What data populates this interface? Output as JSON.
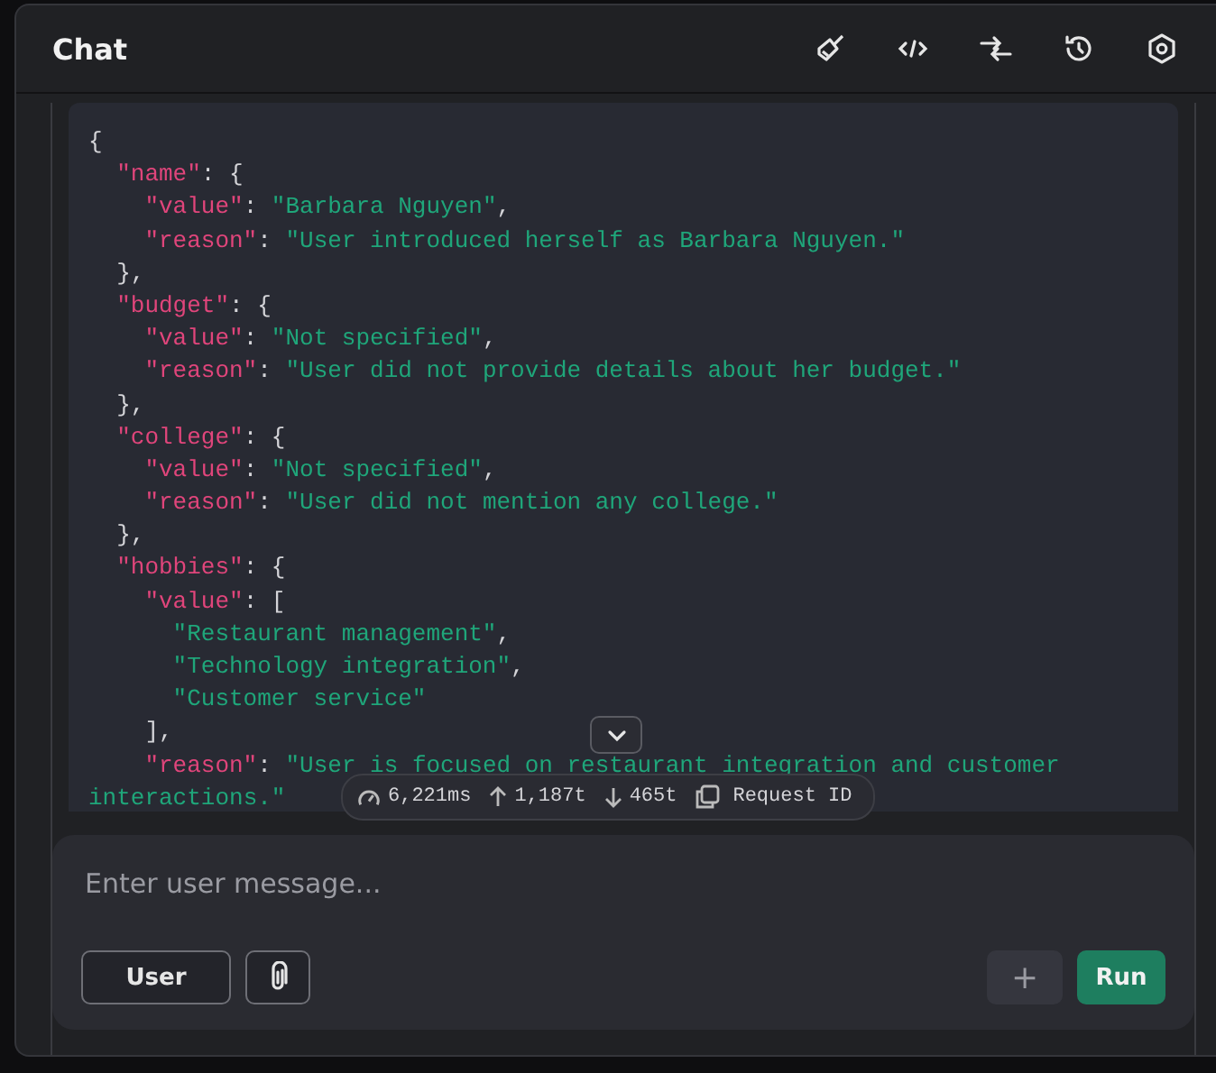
{
  "header": {
    "title": "Chat",
    "tools": [
      {
        "kind": "brush"
      },
      {
        "kind": "code"
      },
      {
        "kind": "arrows"
      },
      {
        "kind": "history"
      },
      {
        "kind": "settings"
      }
    ]
  },
  "code_lines": [
    {
      "parts": [
        {
          "kind": "punct",
          "text": "{"
        }
      ]
    },
    {
      "parts": [
        {
          "kind": "key",
          "text": "\"name\""
        },
        {
          "kind": "punct",
          "text": ":"
        },
        {
          "kind": "punct",
          "text": "{"
        }
      ]
    },
    {
      "parts": [
        {
          "kind": "key",
          "text": "\"value\""
        },
        {
          "kind": "punct",
          "text": ":"
        },
        {
          "kind": "str",
          "text": "\"Barbara Nguyen\""
        },
        {
          "kind": "punct",
          "text": ","
        }
      ]
    },
    {
      "parts": [
        {
          "kind": "key",
          "text": "\"reason\""
        },
        {
          "kind": "punct",
          "text": ":"
        },
        {
          "kind": "str",
          "text": "\"User introduced herself as Barbara Nguyen.\""
        }
      ]
    },
    {
      "parts": [
        {
          "kind": "punct",
          "text": "},"
        }
      ]
    },
    {
      "parts": [
        {
          "kind": "key",
          "text": "\"budget\""
        },
        {
          "kind": "punct",
          "text": ":"
        },
        {
          "kind": "punct",
          "text": "{"
        }
      ]
    },
    {
      "parts": [
        {
          "kind": "key",
          "text": "\"value\""
        },
        {
          "kind": "punct",
          "text": ":"
        },
        {
          "kind": "str",
          "text": "\"Not specified\""
        },
        {
          "kind": "punct",
          "text": ","
        }
      ]
    },
    {
      "parts": [
        {
          "kind": "key",
          "text": "\"reason\""
        },
        {
          "kind": "punct",
          "text": ":"
        },
        {
          "kind": "str",
          "text": "\"User did not provide details about her budget.\""
        }
      ]
    },
    {
      "parts": [
        {
          "kind": "punct",
          "text": "},"
        }
      ]
    },
    {
      "parts": [
        {
          "kind": "key",
          "text": "\"college\""
        },
        {
          "kind": "punct",
          "text": ":"
        },
        {
          "kind": "punct",
          "text": "{"
        }
      ]
    },
    {
      "parts": [
        {
          "kind": "key",
          "text": "\"value\""
        },
        {
          "kind": "punct",
          "text": ":"
        },
        {
          "kind": "str",
          "text": "\"Not specified\""
        },
        {
          "kind": "punct",
          "text": ","
        }
      ]
    },
    {
      "parts": [
        {
          "kind": "key",
          "text": "\"reason\""
        },
        {
          "kind": "punct",
          "text": ":"
        },
        {
          "kind": "str",
          "text": "\"User did not mention any college.\""
        }
      ]
    },
    {
      "parts": [
        {
          "kind": "punct",
          "text": "},"
        }
      ]
    },
    {
      "parts": [
        {
          "kind": "key",
          "text": "\"hobbies\""
        },
        {
          "kind": "punct",
          "text": ":"
        },
        {
          "kind": "punct",
          "text": "{"
        }
      ]
    },
    {
      "parts": [
        {
          "kind": "key",
          "text": "\"value\""
        },
        {
          "kind": "punct",
          "text": ":"
        },
        {
          "kind": "punct",
          "text": "["
        }
      ]
    },
    {
      "parts": [
        {
          "kind": "str",
          "text": "\"Restaurant management\""
        },
        {
          "kind": "punct",
          "text": ","
        }
      ]
    },
    {
      "parts": [
        {
          "kind": "str",
          "text": "\"Technology integration\""
        },
        {
          "kind": "punct",
          "text": ","
        }
      ]
    },
    {
      "parts": [
        {
          "kind": "str",
          "text": "\"Customer service\""
        }
      ]
    },
    {
      "parts": [
        {
          "kind": "punct",
          "text": "],"
        }
      ]
    },
    {
      "parts": [
        {
          "kind": "key",
          "text": "\"reason\""
        },
        {
          "kind": "punct",
          "text": ":"
        },
        {
          "kind": "str",
          "text": "\"User is focused on restaurant integration and customer"
        }
      ]
    },
    {
      "wrapped": true,
      "parts": [
        {
          "kind": "str",
          "text": "interactions.\""
        }
      ]
    }
  ],
  "stats": {
    "duration": "6,221ms",
    "tokens_in": "1,187t",
    "tokens_out": "465t",
    "request_id": "Request ID"
  },
  "composer": {
    "placeholder": "Enter user message...",
    "role": "User",
    "run": "Run",
    "add": "+"
  }
}
